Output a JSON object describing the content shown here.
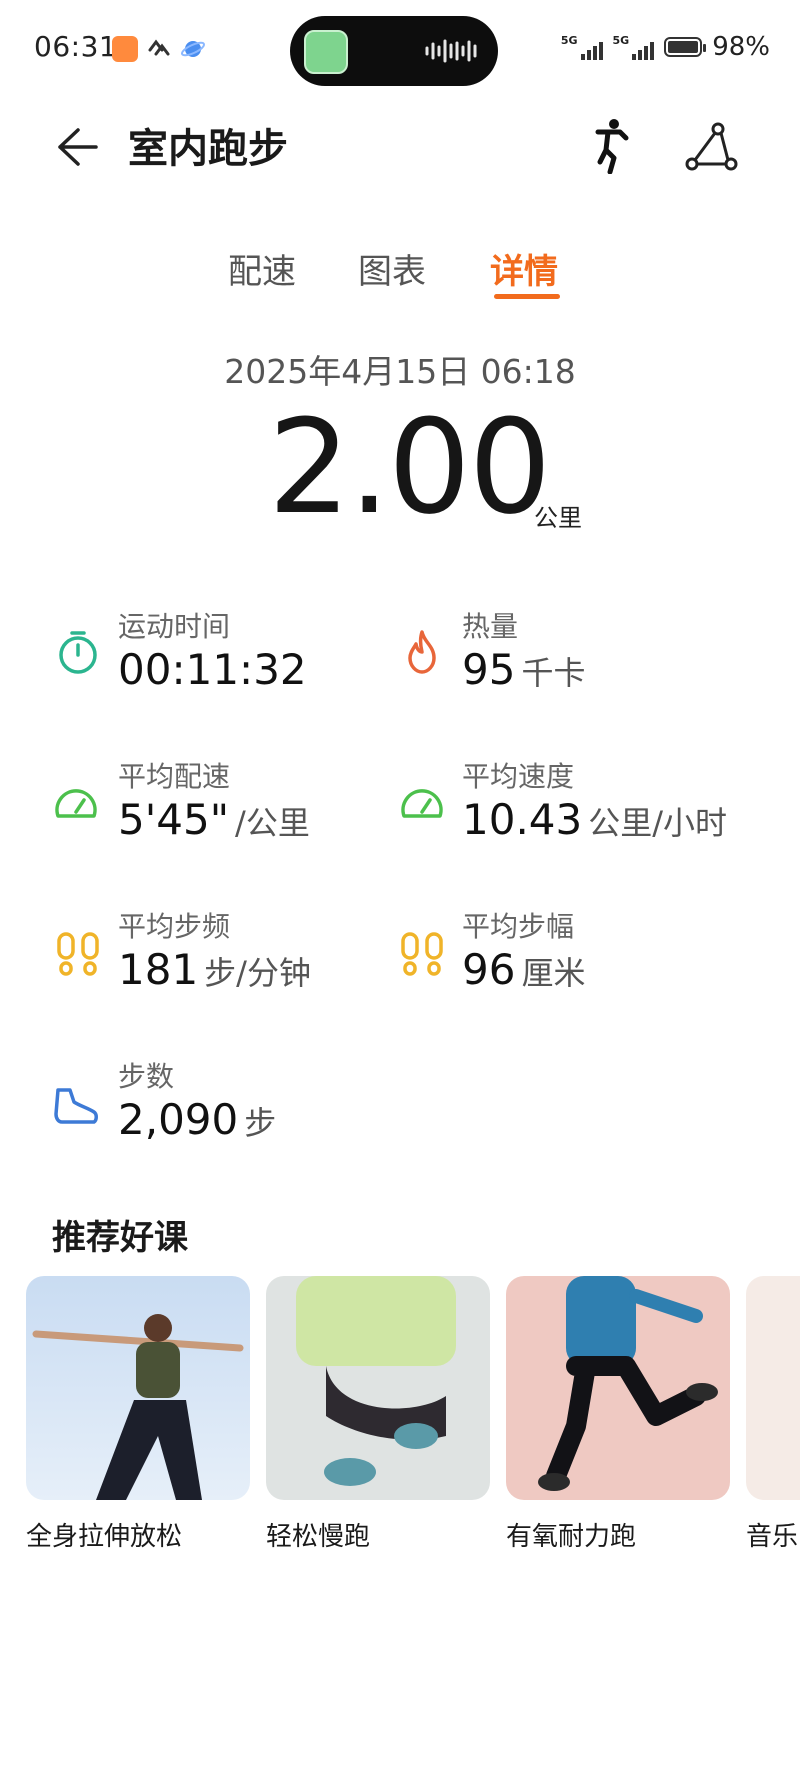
{
  "status_bar": {
    "time": "06:31",
    "battery": "98%",
    "signal_1": "5G",
    "signal_2": "5G"
  },
  "header": {
    "title": "室内跑步"
  },
  "tabs": [
    {
      "label": "配速",
      "active": false
    },
    {
      "label": "图表",
      "active": false
    },
    {
      "label": "详情",
      "active": true
    }
  ],
  "summary": {
    "datetime": "2025年4月15日 06:18",
    "distance": "2.00",
    "distance_unit": "公里"
  },
  "metrics": {
    "duration": {
      "label": "运动时间",
      "value": "00:11:32",
      "unit": ""
    },
    "calories": {
      "label": "热量",
      "value": "95",
      "unit": "千卡"
    },
    "avg_pace": {
      "label": "平均配速",
      "value": "5'45\"",
      "unit": "/公里"
    },
    "avg_speed": {
      "label": "平均速度",
      "value": "10.43",
      "unit": "公里/小时"
    },
    "cadence": {
      "label": "平均步频",
      "value": "181",
      "unit": "步/分钟"
    },
    "stride": {
      "label": "平均步幅",
      "value": "96",
      "unit": "厘米"
    },
    "steps": {
      "label": "步数",
      "value": "2,090",
      "unit": "步"
    }
  },
  "courses": {
    "title": "推荐好课",
    "items": [
      {
        "label": "全身拉伸放松"
      },
      {
        "label": "轻松慢跑"
      },
      {
        "label": "有氧耐力跑"
      },
      {
        "label": "音乐"
      }
    ]
  },
  "colors": {
    "accent": "#f26b1d",
    "teal": "#2bb58f",
    "green": "#4cc04c",
    "yellow": "#f0b429",
    "blue": "#3d7ad6",
    "fire": "#e8663a"
  }
}
